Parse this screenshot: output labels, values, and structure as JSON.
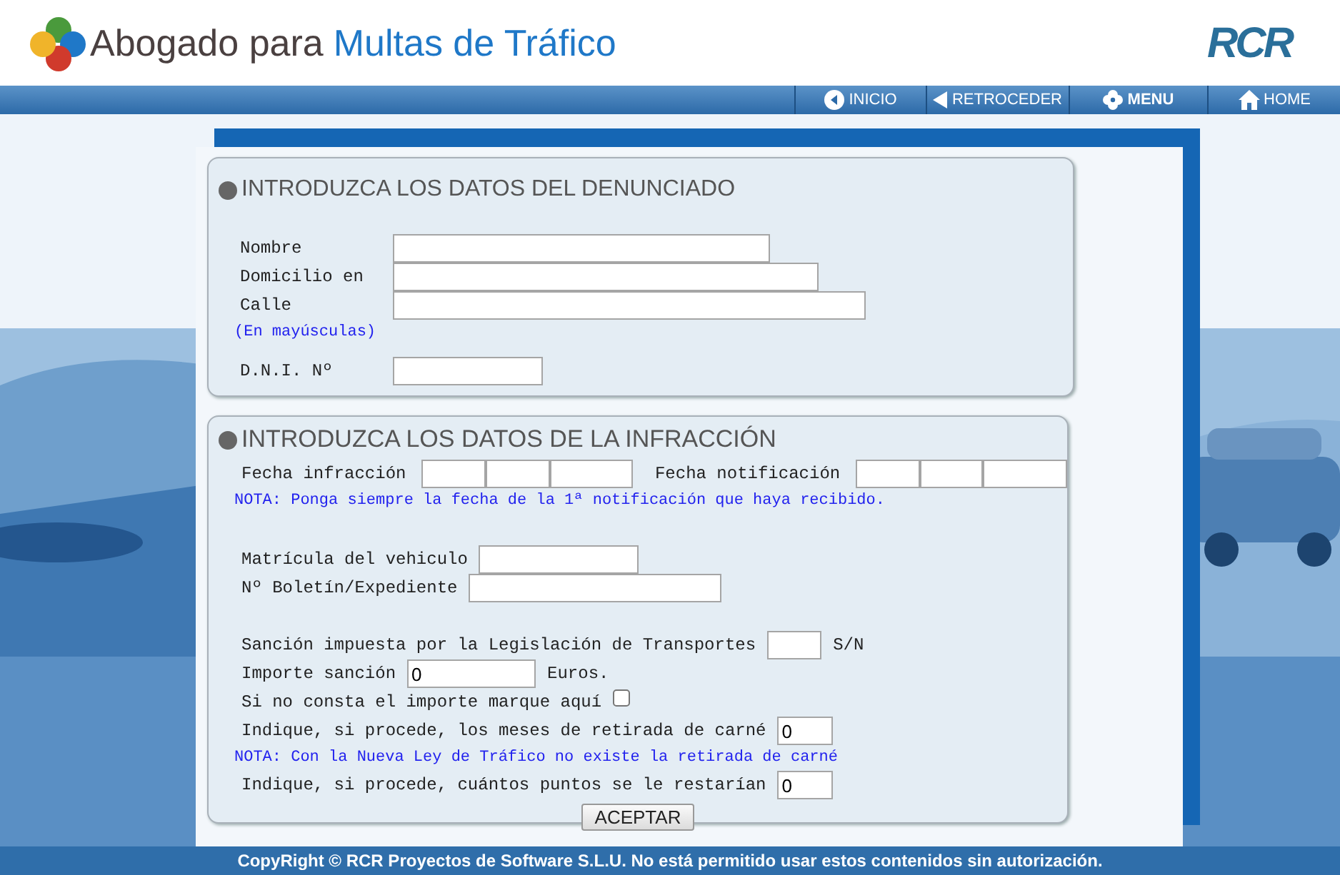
{
  "header": {
    "title_part_1": "Abogado para",
    "title_part_2": "Multas de Tráfico",
    "brand_logo": "RCR"
  },
  "nav": [
    {
      "label": "INICIO",
      "kind": "circle-back"
    },
    {
      "label": "RETROCEDER",
      "kind": "triangle-back"
    },
    {
      "label": "MENU",
      "kind": "flower"
    },
    {
      "label": "HOME",
      "kind": "house"
    }
  ],
  "section_1": {
    "title": "INTRODUZCA LOS DATOS DEL DENUNCIADO",
    "rows": [
      {
        "kind": "field",
        "label": "Nombre"
      },
      {
        "kind": "field",
        "label": "Domicilio en"
      },
      {
        "kind": "field",
        "label": "Calle"
      },
      {
        "kind": "note",
        "text": "(En mayúsculas)"
      },
      {
        "kind": "field",
        "label": "D.N.I. Nº"
      }
    ]
  },
  "section_2": {
    "title": "INTRODUZCA LOS DATOS DE LA INFRACCIÓN",
    "groups": [
      [
        {
          "kind": "dates",
          "label": "Fecha infracción",
          "label_2": "Fecha notificación"
        },
        {
          "kind": "note",
          "text": "NOTA: Ponga siempre la fecha de la 1ª notificación que haya recibido."
        }
      ],
      [
        {
          "kind": "field",
          "label": "Matrícula del vehiculo"
        },
        {
          "kind": "field",
          "label": "Nº Boletín/Expediente"
        }
      ],
      [
        {
          "kind": "field",
          "label": "Sanción impuesta por la Legislación de Transportes",
          "suffix": "S/N"
        },
        {
          "kind": "field",
          "label": "Importe sanción",
          "value": "0",
          "suffix": "Euros."
        },
        {
          "kind": "checkbox",
          "label": "Si no consta el importe marque aquí",
          "checked": false
        },
        {
          "kind": "field",
          "label": "Indique, si procede, los meses de retirada de carné",
          "value": "0"
        },
        {
          "kind": "note",
          "text": "NOTA: Con la Nueva Ley de Tráfico no existe la retirada de carné"
        },
        {
          "kind": "field",
          "label": "Indique, si procede, cuántos puntos se le restarían",
          "value": "0"
        }
      ]
    ]
  },
  "submit_button": "ACEPTAR",
  "footer": "CopyRight © RCR Proyectos de Software S.L.U. No está permitido usar estos contenidos sin autorización."
}
